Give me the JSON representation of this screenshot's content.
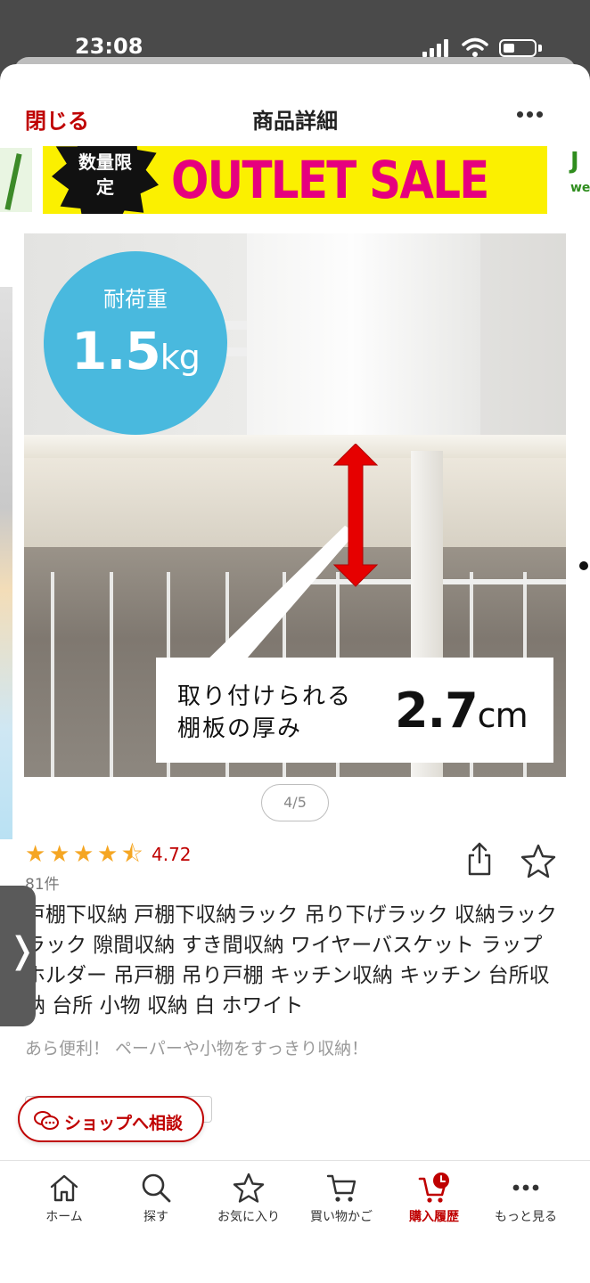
{
  "status_bar": {
    "time": "23:08"
  },
  "header": {
    "close_label": "閉じる",
    "title": "商品詳細"
  },
  "banner": {
    "badge": "数量限定",
    "text": "OUTLET SALE",
    "next_text": "J",
    "next_sub": "we"
  },
  "product_image": {
    "load_label": "耐荷重",
    "load_value": "1.5",
    "load_unit": "kg",
    "thickness_label_line1": "取り付けられる",
    "thickness_label_line2": "棚板の厚み",
    "thickness_value": "2.7",
    "thickness_unit": "cm"
  },
  "pager": {
    "text": "4/5",
    "current": 4,
    "total": 5
  },
  "rating": {
    "value": "4.72",
    "stars": 4.72,
    "count": "81件"
  },
  "product": {
    "title": "戸棚下収納 戸棚下収納ラック 吊り下げラック 収納ラック ラック 隙間収納 すき間収納 ワイヤーバスケット ラップホルダー 吊戸棚 吊り戸棚 キッチン収納 キッチン 台所収納 台所 小物 収納 白 ホワイト",
    "catch_copy": "あら便利！ ペーパーや小物をすっきり収納！"
  },
  "edge_tab": {
    "glyph": "❭"
  },
  "consult": {
    "label": "ショップへ相談"
  },
  "bottom_nav": {
    "items": [
      {
        "label": "ホーム",
        "icon": "home-icon"
      },
      {
        "label": "探す",
        "icon": "search-icon"
      },
      {
        "label": "お気に入り",
        "icon": "star-icon"
      },
      {
        "label": "買い物かご",
        "icon": "cart-icon"
      },
      {
        "label": "購入履歴",
        "icon": "purchase-history-icon"
      },
      {
        "label": "もっと見る",
        "icon": "more-icon"
      }
    ],
    "active_index": 4
  },
  "colors": {
    "accent": "#bf0000",
    "star": "#f5a623",
    "load_circle": "#49b9de",
    "banner_bg": "#fbf000",
    "banner_text": "#e6007e"
  }
}
